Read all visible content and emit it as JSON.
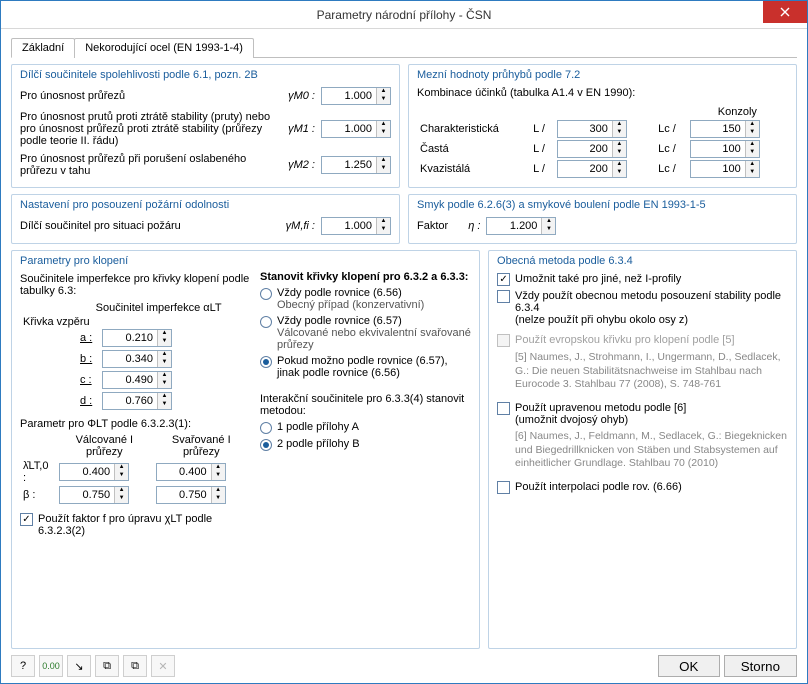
{
  "window": {
    "title": "Parametry národní přílohy - ČSN"
  },
  "tabs": {
    "basic": "Základní",
    "stainless": "Nekorodující ocel (EN 1993-1-4)"
  },
  "group_partial": {
    "title": "Dílčí součinitele spolehlivosti podle 6.1, pozn. 2B",
    "row1_label": "Pro únosnost průřezů",
    "row1_sym": "γM0 :",
    "row1_val": "1.000",
    "row2_label": "Pro únosnost prutů proti ztrátě stability (pruty) nebo pro únosnost průřezů proti ztrátě stability (průřezy podle teorie II. řádu)",
    "row2_sym": "γM1 :",
    "row2_val": "1.000",
    "row3_label": "Pro únosnost průřezů při porušení oslabeného průřezu v tahu",
    "row3_sym": "γM2 :",
    "row3_val": "1.250"
  },
  "group_defl": {
    "title": "Mezní hodnoty průhybů podle 7.2",
    "combo_label": "Kombinace účinků (tabulka A1.4 v EN 1990):",
    "col_console": "Konzoly",
    "rows": [
      {
        "label": "Charakteristická",
        "l": "300",
        "lc": "150"
      },
      {
        "label": "Častá",
        "l": "200",
        "lc": "100"
      },
      {
        "label": "Kvazistálá",
        "l": "200",
        "lc": "100"
      }
    ],
    "L": "L /",
    "Lc": "Lc /"
  },
  "group_fire": {
    "title": "Nastavení pro posouzení požární odolnosti",
    "label": "Dílčí součinitel pro situaci požáru",
    "sym": "γM,fi :",
    "val": "1.000"
  },
  "group_shear": {
    "title": "Smyk podle 6.2.6(3) a smykové boulení podle EN 1993-1-5",
    "label": "Faktor",
    "sym": "η :",
    "val": "1.200"
  },
  "group_ltb": {
    "title": "Parametry pro klopení",
    "imperf_label": "Součinitele imperfekce pro křivky klopení podle tabulky 6.3:",
    "col_curve": "Křivka vzpěru",
    "col_imp": "Součinitel imperfekce αLT",
    "rows": [
      {
        "k": "a",
        "v": "0.210"
      },
      {
        "k": "b",
        "v": "0.340"
      },
      {
        "k": "c",
        "v": "0.490"
      },
      {
        "k": "d",
        "v": "0.760"
      }
    ],
    "phi_label": "Parametr pro ΦLT  podle 6.3.2.3(1):",
    "col_roll": "Válcované I průřezy",
    "col_weld": "Svařované I průřezy",
    "lambda_sym": "λ̄LT,0 :",
    "lambda_r": "0.400",
    "lambda_w": "0.400",
    "beta_sym": "β :",
    "beta_r": "0.750",
    "beta_w": "0.750",
    "chk_f": "Použít faktor f pro úpravu χLT podle 6.3.2.3(2)",
    "curves_title": "Stanovit křivky klopení pro 6.3.2 a 6.3.3:",
    "opt1": "Vždy podle rovnice (6.56)",
    "opt1_sub": "Obecný případ (konzervativní)",
    "opt2": "Vždy podle rovnice (6.57)",
    "opt2_sub": "Válcované nebo ekvivalentní svařované průřezy",
    "opt3": "Pokud možno podle rovnice (6.57), jinak podle rovnice (6.56)",
    "interact_title": "Interakční součinitele pro 6.3.3(4) stanovit metodou:",
    "annex1": "1 podle přílohy A",
    "annex2": "2 podle přílohy B"
  },
  "group_gen": {
    "title": "Obecná metoda podle 6.3.4",
    "chk1": "Umožnit také pro jiné, než I-profily",
    "chk2": "Vždy použít obecnou metodu posouzení stability podle 6.3.4",
    "chk2_sub": "(nelze použít při ohybu okolo osy z)",
    "chk3": "Použít evropskou křivku pro klopení podle [5]",
    "ref5": "[5] Naumes, J., Strohmann, I., Ungermann, D., Sedlacek, G.: Die neuen Stabilitätsnachweise im Stahlbau nach Eurocode 3. Stahlbau 77 (2008), S. 748-761",
    "chk4": "Použít upravenou metodu podle [6]",
    "chk4_sub": "(umožnit dvojosý ohyb)",
    "ref6": "[6] Naumes, J., Feldmann, M., Sedlacek, G.: Biegeknicken und Biegedrillknicken von Stäben und Stabsystemen auf einheitlicher Grundlage. Stahlbau 70 (2010)",
    "chk5": "Použít interpolaci podle rov.  (6.66)"
  },
  "footer": {
    "ok": "OK",
    "cancel": "Storno"
  }
}
